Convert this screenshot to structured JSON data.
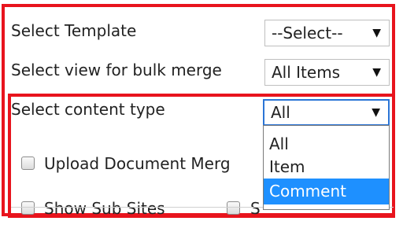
{
  "form": {
    "template": {
      "label": "Select Template",
      "value": "--Select--"
    },
    "view": {
      "label": "Select view for bulk merge",
      "value": "All Items"
    },
    "content_type": {
      "label": "Select content type",
      "value": "All",
      "options": [
        "All",
        "Item",
        "Comment"
      ],
      "highlighted": "Comment"
    },
    "upload_checkbox_label": "Upload Document Merg",
    "show_sub_sites_label": "Show Sub Sites",
    "truncated_checkbox_label": "S"
  },
  "colors": {
    "highlight_frame": "#e8141d",
    "focus_border": "#2b75d6",
    "selected_option_bg": "#1e90ff"
  },
  "icons": {
    "select_arrow": "▼"
  }
}
